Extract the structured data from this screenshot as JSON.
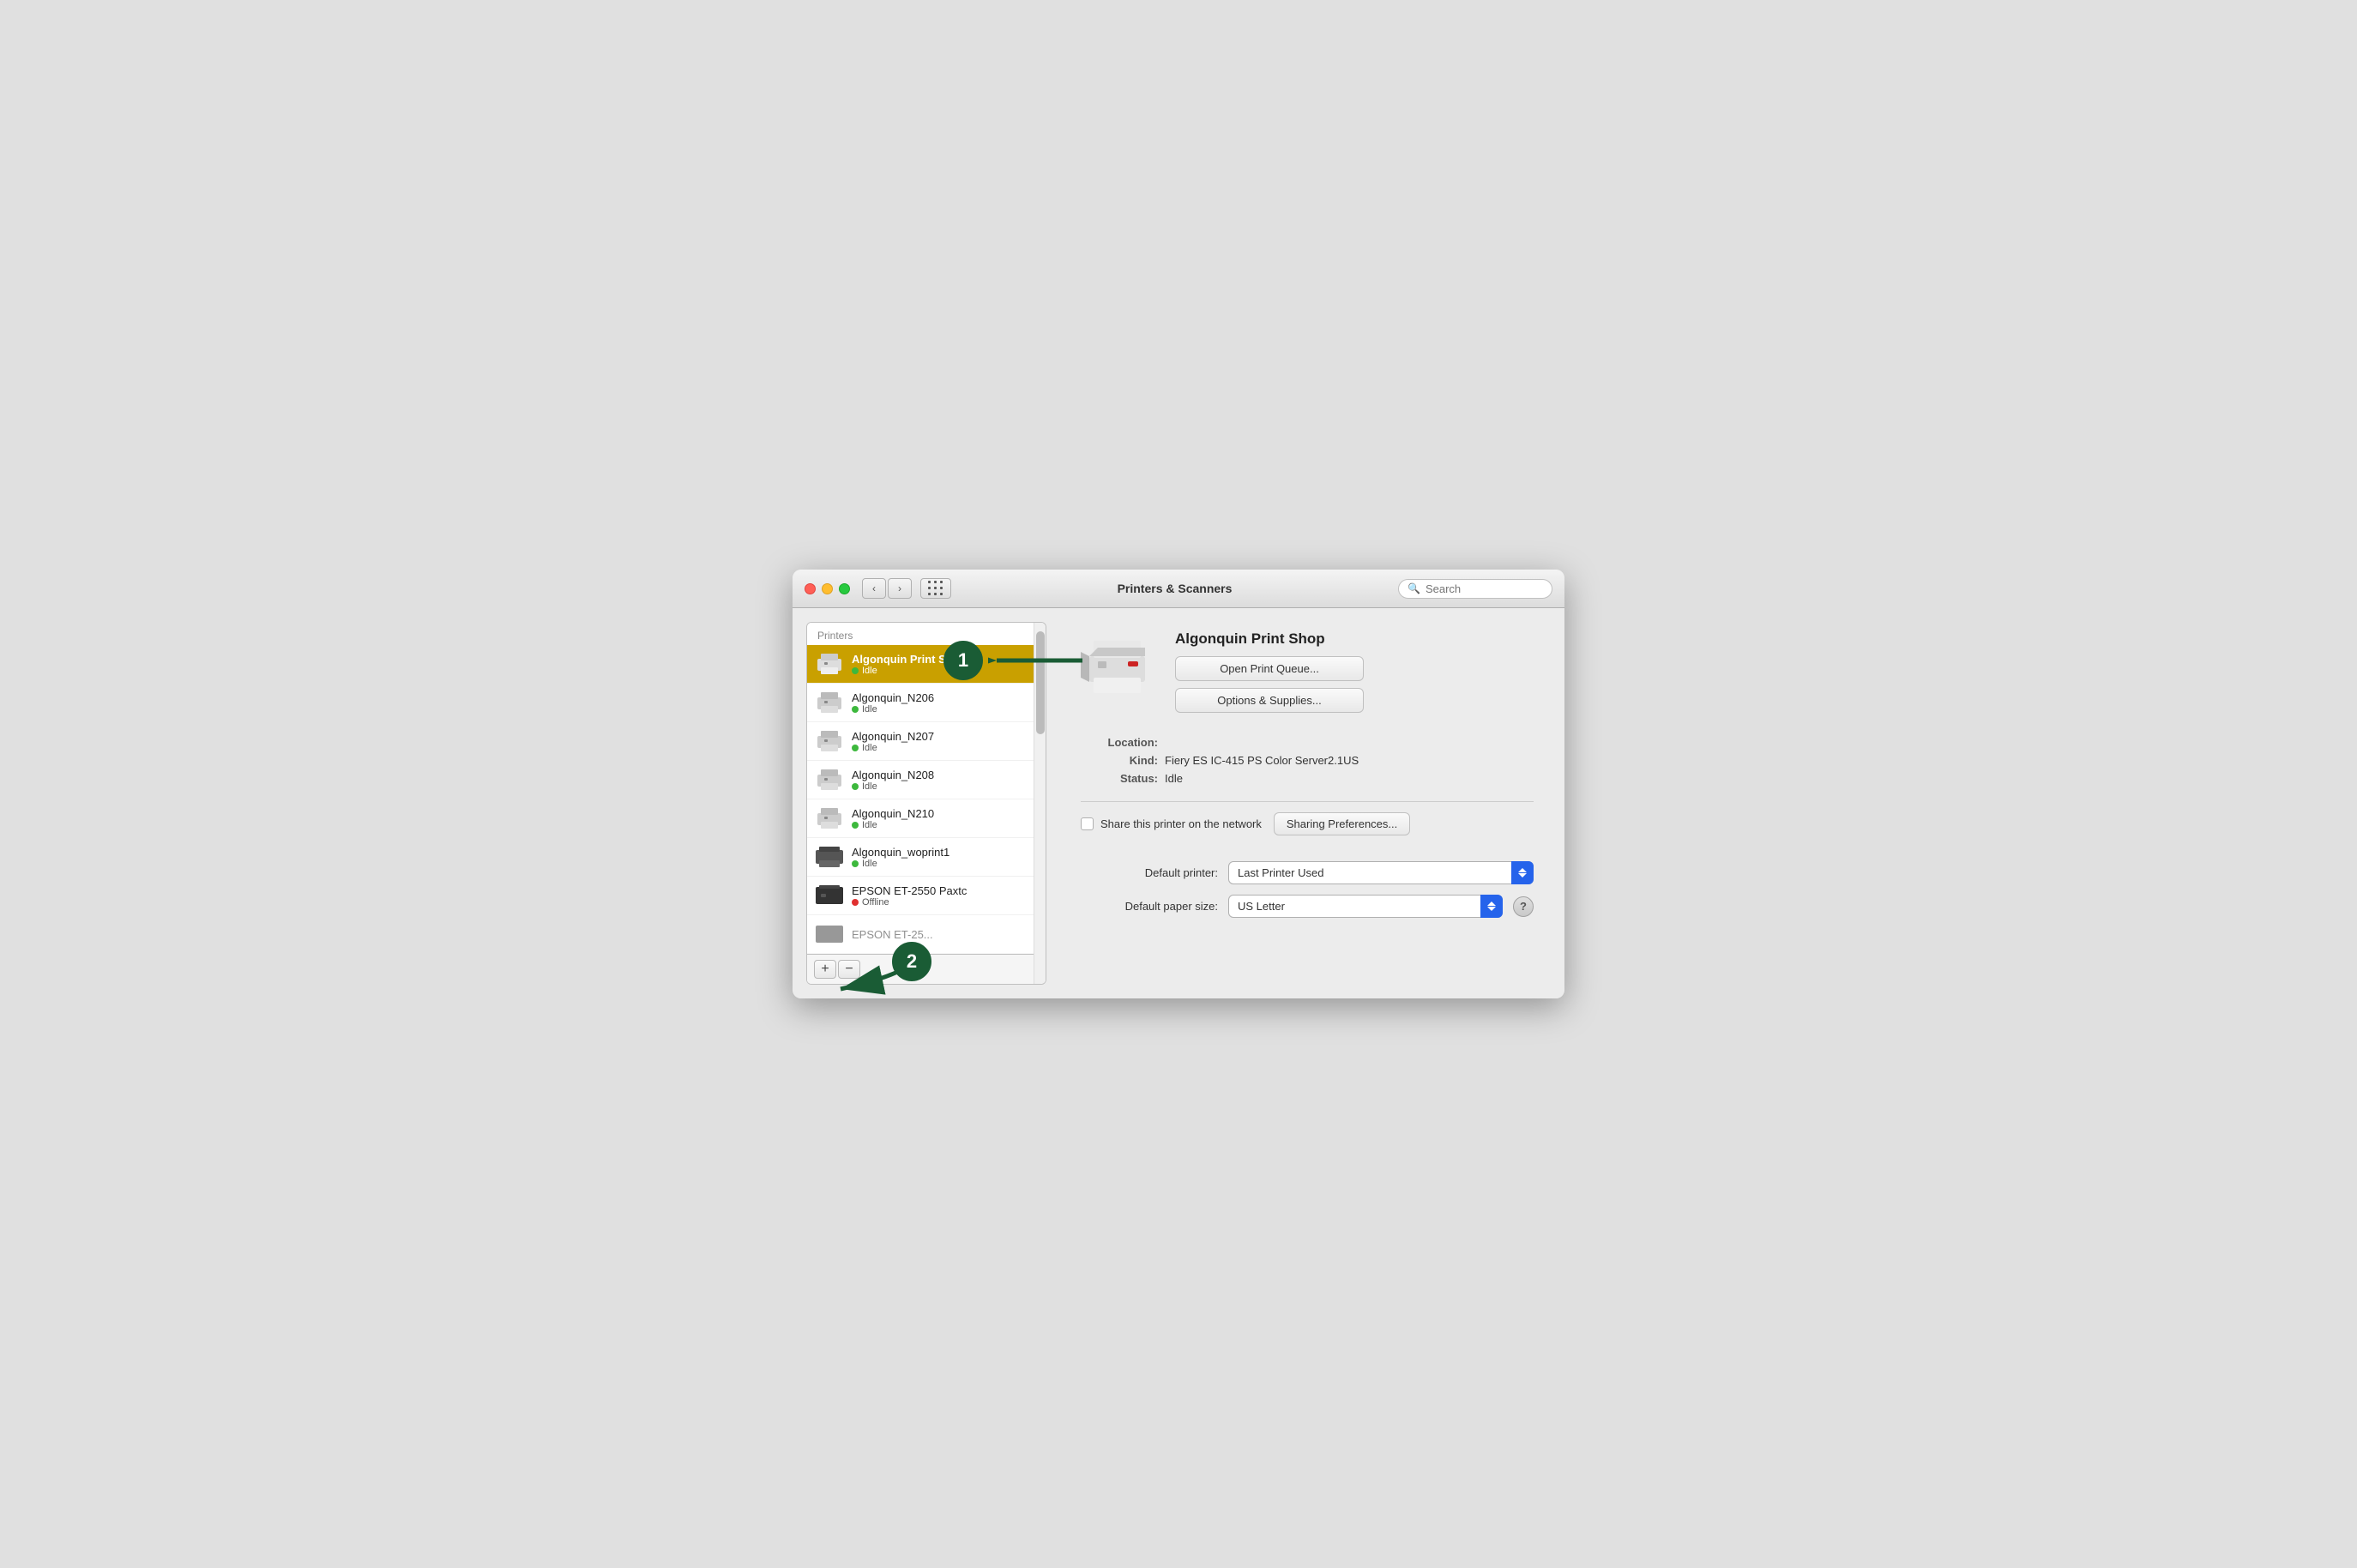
{
  "window": {
    "title": "Printers & Scanners"
  },
  "titlebar": {
    "back_label": "‹",
    "forward_label": "›",
    "search_placeholder": "Search"
  },
  "sidebar": {
    "header": "Printers",
    "printers": [
      {
        "name": "Algonquin Print Shop",
        "status": "Idle",
        "status_color": "green",
        "selected": true
      },
      {
        "name": "Algonquin_N206",
        "status": "Idle",
        "status_color": "green",
        "selected": false
      },
      {
        "name": "Algonquin_N207",
        "status": "Idle",
        "status_color": "green",
        "selected": false
      },
      {
        "name": "Algonquin_N208",
        "status": "Idle",
        "status_color": "green",
        "selected": false
      },
      {
        "name": "Algonquin_N210",
        "status": "Idle",
        "status_color": "green",
        "selected": false
      },
      {
        "name": "Algonquin_woprint1",
        "status": "Idle",
        "status_color": "green",
        "selected": false
      },
      {
        "name": "EPSON ET-2550 Paxtc",
        "status": "Offline",
        "status_color": "red",
        "selected": false
      },
      {
        "name": "EPSON ET-25...",
        "status": "",
        "status_color": "",
        "selected": false,
        "truncated": true
      }
    ],
    "add_label": "+",
    "remove_label": "−"
  },
  "detail": {
    "printer_name": "Algonquin Print Shop",
    "open_queue_label": "Open Print Queue...",
    "options_label": "Options & Supplies...",
    "location_label": "Location:",
    "location_value": "",
    "kind_label": "Kind:",
    "kind_value": "Fiery ES IC-415 PS Color Server2.1US",
    "status_label": "Status:",
    "status_value": "Idle",
    "share_label": "Share this printer on the network",
    "sharing_pref_label": "Sharing Preferences...",
    "default_printer_label": "Default printer:",
    "default_printer_value": "Last Printer Used",
    "default_paper_label": "Default paper size:",
    "default_paper_value": "US Letter"
  },
  "annotations": {
    "badge1": "1",
    "badge2": "2"
  },
  "colors": {
    "selected_bg": "#c9a000",
    "arrow_color": "#1a5c35",
    "blue_arrow": "#2563eb"
  }
}
